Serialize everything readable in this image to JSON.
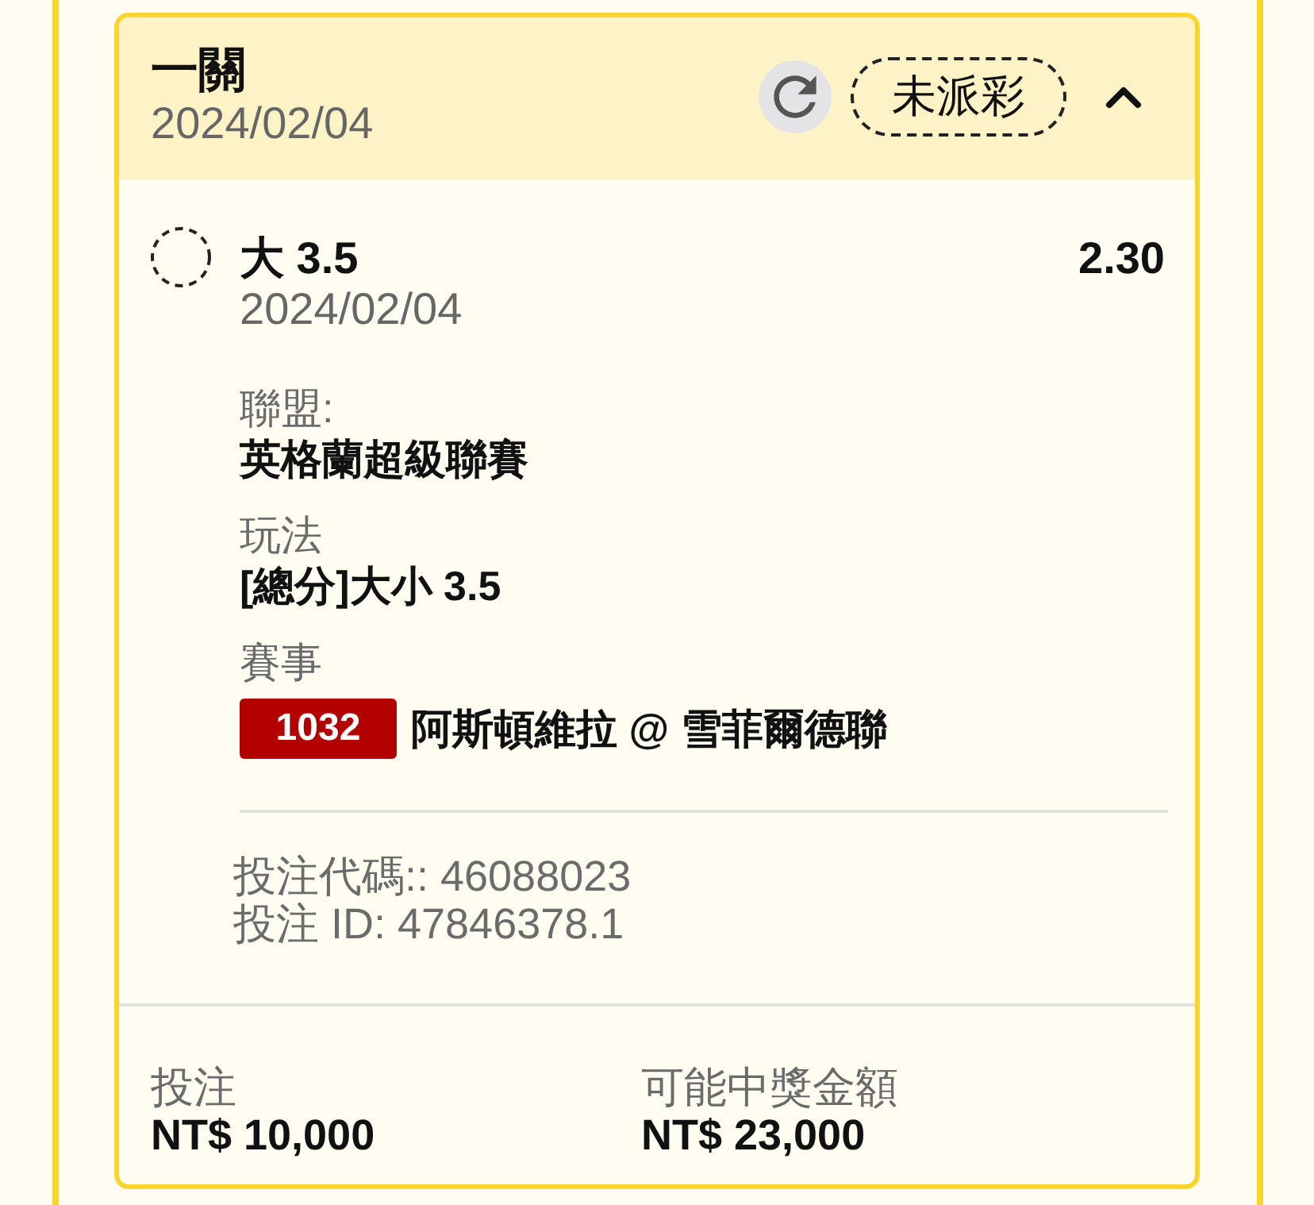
{
  "bet": {
    "title": "一關",
    "date": "2024/02/04",
    "status": "未派彩",
    "expanded": true
  },
  "selections": [
    {
      "pick": "大 3.5",
      "odds": "2.30",
      "date": "2024/02/04",
      "settled": false,
      "details": [
        {
          "kind": "text",
          "label": "聯盟:",
          "value": "英格蘭超級聯賽"
        },
        {
          "kind": "text",
          "label": "玩法",
          "value": "[總分]大小 3.5"
        },
        {
          "kind": "match",
          "label": "賽事",
          "code": "1032",
          "value": "阿斯頓維拉 @ 雪菲爾德聯"
        }
      ]
    }
  ],
  "references": [
    "投注代碼:: 46088023",
    "投注 ID: 47846378.1"
  ],
  "summary": [
    {
      "label": "投注",
      "value": "NT$ 10,000"
    },
    {
      "label": "可能中獎金額",
      "value": "NT$ 23,000"
    }
  ]
}
